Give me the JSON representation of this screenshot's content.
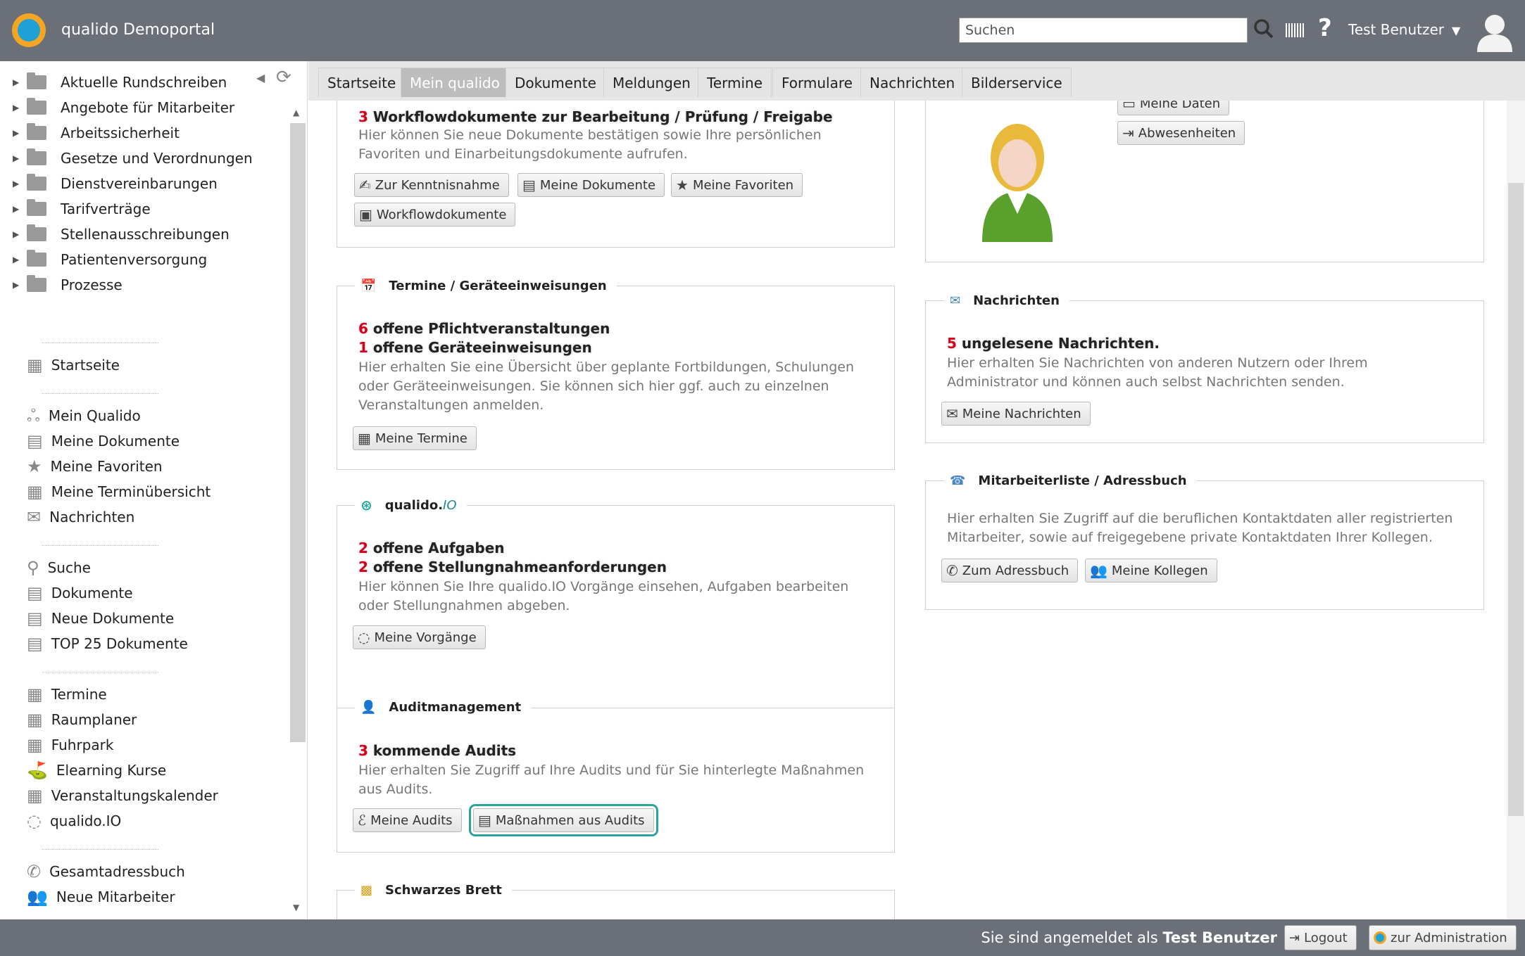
{
  "header": {
    "title": "qualido Demoportal",
    "search_placeholder": "Suchen",
    "help": "?",
    "user": "Test Benutzer",
    "caret": "▼"
  },
  "sidebar": {
    "collapse": "◀",
    "refresh": "⟳",
    "folders": [
      "Aktuelle Rundschreiben",
      "Angebote für Mitarbeiter",
      "Arbeitssicherheit",
      "Gesetze und Verordnungen",
      "Dienstvereinbarungen",
      "Tarifverträge",
      "Stellenausschreibungen",
      "Patientenversorgung",
      "Prozesse"
    ],
    "groups": [
      [
        "Startseite"
      ],
      [
        "Mein Qualido",
        "Meine Dokumente",
        "Meine Favoriten",
        "Meine Terminübersicht",
        "Nachrichten"
      ],
      [
        "Suche",
        "Dokumente",
        "Neue Dokumente",
        "TOP 25 Dokumente"
      ],
      [
        "Termine",
        "Raumplaner",
        "Fuhrpark",
        "Elearning Kurse",
        "Veranstaltungskalender",
        "qualido.IO"
      ],
      [
        "Gesamtadressbuch",
        "Neue Mitarbeiter"
      ]
    ]
  },
  "tabs": [
    "Startseite",
    "Mein qualido",
    "Dokumente",
    "Meldungen",
    "Termine",
    "Formulare",
    "Nachrichten",
    "Bilderservice"
  ],
  "workflow": {
    "count": "3",
    "headline": "Workflowdokumente zur Bearbeitung / Prüfung / Freigabe",
    "desc": "Hier können Sie neue Dokumente bestätigen sowie Ihre persönlichen Favoriten und Einarbeitungsdokumente aufrufen.",
    "buttons": [
      "Zur Kenntnisnahme",
      "Meine Dokumente",
      "Meine Favoriten",
      "Workflowdokumente"
    ]
  },
  "termine": {
    "title": "Termine / Geräteeinweisungen",
    "count1": "6",
    "line1": "offene Pflichtveranstaltungen",
    "count2": "1",
    "line2": "offene Geräteeinweisungen",
    "desc": "Hier erhalten Sie eine Übersicht über geplante Fortbildungen, Schulungen oder Geräteeinweisungen. Sie können sich hier ggf. auch zu einzelnen Veranstaltungen anmelden.",
    "button": "Meine Termine"
  },
  "qualidoio": {
    "title": "qualido.",
    "title_italic": "IO",
    "count1": "2",
    "line1": "offene Aufgaben",
    "count2": "2",
    "line2": "offene Stellungnahmeanforderungen",
    "desc": "Hier können Sie Ihre qualido.IO Vorgänge einsehen, Aufgaben bearbeiten oder Stellungnahmen abgeben.",
    "button": "Meine Vorgänge"
  },
  "audit": {
    "title": "Auditmanagement",
    "count": "3",
    "line": "kommende Audits",
    "desc": "Hier erhalten Sie Zugriff auf Ihre Audits und für Sie hinterlegte Maßnahmen aus Audits.",
    "buttons": [
      "Meine Audits",
      "Maßnahmen aus Audits"
    ]
  },
  "brett": {
    "title": "Schwarzes Brett"
  },
  "profile": {
    "buttons": [
      "Meine Daten",
      "Abwesenheiten"
    ]
  },
  "messages": {
    "title": "Nachrichten",
    "count": "5",
    "line": "ungelesene Nachrichten.",
    "desc": "Hier erhalten Sie Nachrichten von anderen Nutzern oder Ihrem Administrator und können auch selbst Nachrichten senden.",
    "button": "Meine Nachrichten"
  },
  "contacts": {
    "title": "Mitarbeiterliste / Adressbuch",
    "desc": "Hier erhalten Sie Zugriff auf die beruflichen Kontaktdaten aller registrierten Mitarbeiter, sowie auf freigegebene private Kontaktdaten Ihrer Kollegen.",
    "buttons": [
      "Zum Adressbuch",
      "Meine Kollegen"
    ]
  },
  "footer": {
    "prefix": "Sie sind angemeldet als ",
    "user": "Test Benutzer",
    "logout": "Logout",
    "admin": "zur Administration"
  },
  "colors": {
    "topbar": "#6b7078",
    "count_red": "#d0021b",
    "focus": "#2aa39b"
  }
}
